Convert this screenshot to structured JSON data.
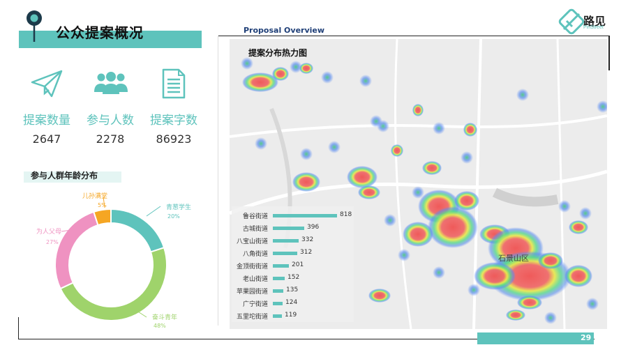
{
  "header": {
    "title": "公众提案概况",
    "overview_label": "Proposal Overview",
    "map_title": "提案分布热力图"
  },
  "logo": {
    "name": "路见",
    "sub": "PinStreet"
  },
  "stats": [
    {
      "label": "提案数量",
      "value": "2647",
      "icon": "paper-plane-icon"
    },
    {
      "label": "参与人数",
      "value": "2278",
      "icon": "people-group-icon"
    },
    {
      "label": "提案字数",
      "value": "86923",
      "icon": "document-icon"
    }
  ],
  "age": {
    "title": "参与人群年龄分布",
    "segments": [
      {
        "name": "青葱学生",
        "percent": "20%",
        "value": 20,
        "color": "#5ec3bc"
      },
      {
        "name": "奋斗青年",
        "percent": "48%",
        "value": 48,
        "color": "#9fd36b"
      },
      {
        "name": "为人父母",
        "percent": "27%",
        "value": 27,
        "color": "#ef92c1"
      },
      {
        "name": "儿孙满堂",
        "percent": "5%",
        "value": 5,
        "color": "#f5a623"
      }
    ]
  },
  "streets": [
    {
      "name": "鲁谷街道",
      "value": 818
    },
    {
      "name": "古城街道",
      "value": 396
    },
    {
      "name": "八宝山街道",
      "value": 332
    },
    {
      "name": "八角街道",
      "value": 312
    },
    {
      "name": "金顶街街道",
      "value": 201
    },
    {
      "name": "老山街道",
      "value": 152
    },
    {
      "name": "苹果园街道",
      "value": 135
    },
    {
      "name": "广宁街道",
      "value": 124
    },
    {
      "name": "五里坨街道",
      "value": 119
    }
  ],
  "map_label": "石景山区",
  "page_number": "29",
  "colors": {
    "accent": "#5ec3bc",
    "navy": "#1f3f77"
  }
}
